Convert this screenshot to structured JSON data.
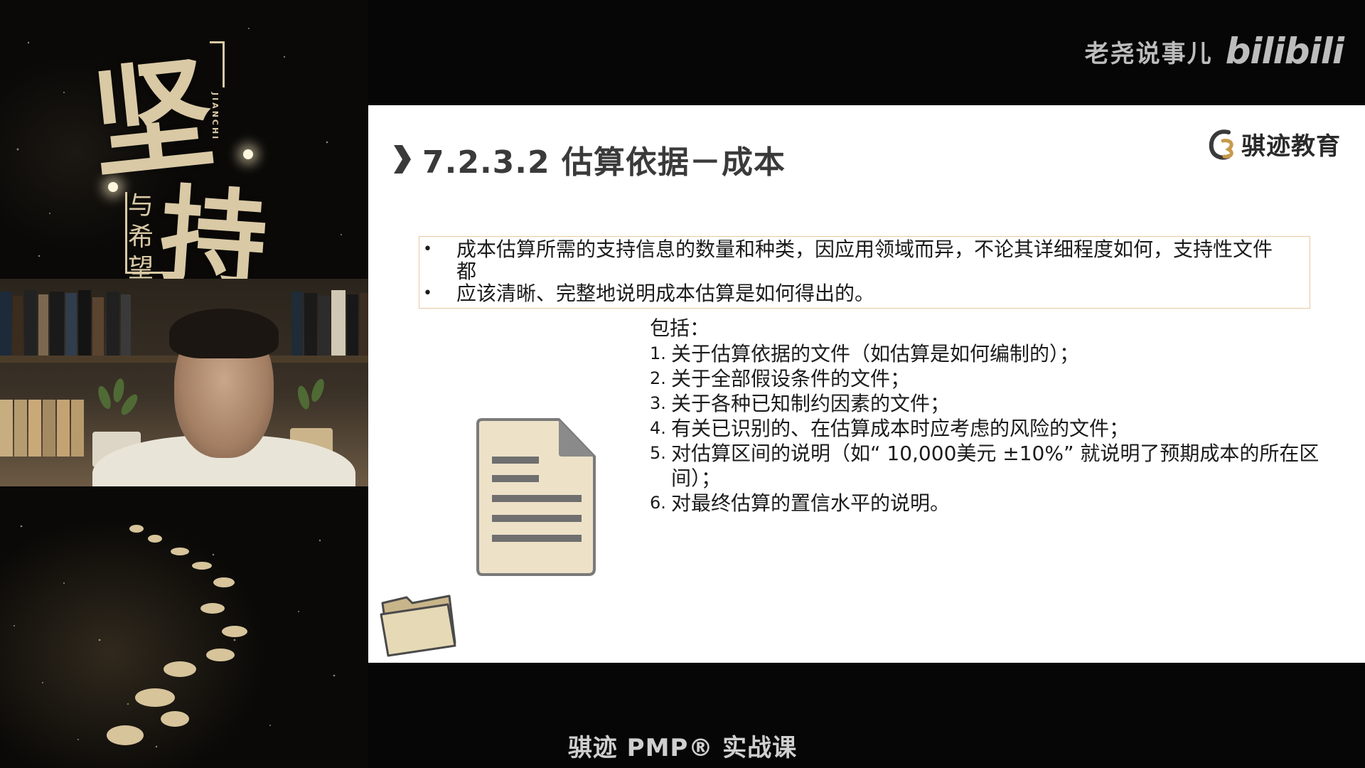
{
  "poster": {
    "char_1": "坚",
    "char_2": "持",
    "sub_text": "与希望",
    "pinyin": "JIANCHI"
  },
  "brand": {
    "channel_name": "老尧说事儿",
    "platform_logo": "bilibili"
  },
  "slide": {
    "title": "7.2.3.2 估算依据－成本",
    "logo_text": "骐迹教育",
    "intro_lines": [
      "成本估算所需的支持信息的数量和种类，因应用领域而异，不论其详细程度如何，支持性文件",
      "都",
      "应该清晰、完整地说明成本估算是如何得出的。"
    ],
    "includes_heading": "包括：",
    "includes_items": [
      {
        "num": "1.",
        "text": "关于估算依据的文件（如估算是如何编制的）；"
      },
      {
        "num": "2.",
        "text": "关于全部假设条件的文件；"
      },
      {
        "num": "3.",
        "text": "关于各种已知制约因素的文件；"
      },
      {
        "num": "4.",
        "text": "有关已识别的、在估算成本时应考虑的风险的文件；"
      },
      {
        "num": "5.",
        "text": "对估算区间的说明（如“ 10,000美元 ±10%” 就说明了预期成本的所在区间）；"
      },
      {
        "num": "6.",
        "text": "对最终估算的置信水平的说明。"
      }
    ]
  },
  "footer": {
    "course_title": "骐迹 PMP® 实战课"
  },
  "colors": {
    "accent_gold": "#d9c9a5",
    "slide_bg": "#ffffff",
    "box_border": "#e8c8a0",
    "doc_fill": "#ede2c8"
  }
}
